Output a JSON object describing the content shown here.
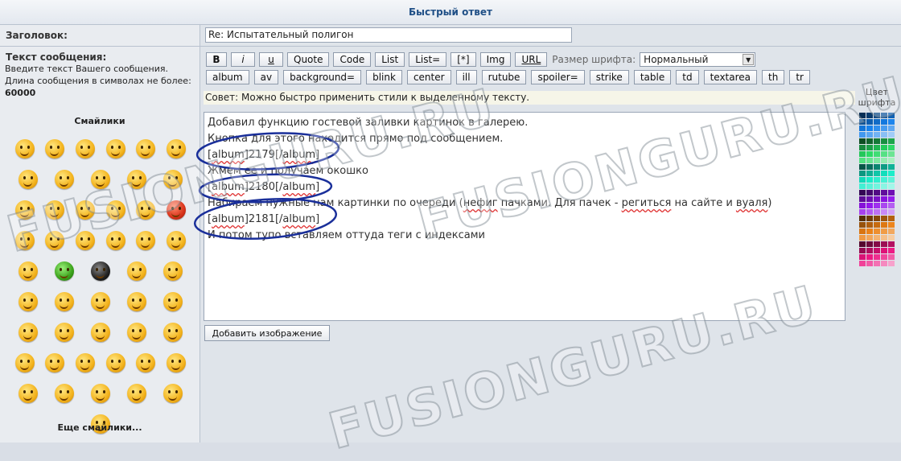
{
  "header": {
    "title": "Быстрый ответ"
  },
  "subject": {
    "label": "Заголовок:",
    "value": "Re: Испытательный полигон"
  },
  "message": {
    "label": "Текст сообщения:",
    "hint1": "Введите текст Вашего сообщения.",
    "hint2": "Длина сообщения в символах не более:",
    "max_len": "60000"
  },
  "smilies": {
    "title": "Смайлики",
    "more": "Еще смайлики..."
  },
  "toolbar": {
    "row1": [
      "B",
      "i",
      "u",
      "Quote",
      "Code",
      "List",
      "List=",
      "[*]",
      "Img",
      "URL"
    ],
    "font_size_label": "Размер шрифта:",
    "font_size_value": "Нормальный",
    "row2": [
      "album",
      "av",
      "background=",
      "blink",
      "center",
      "ill",
      "rutube",
      "spoiler=",
      "strike",
      "table",
      "td",
      "textarea",
      "th",
      "tr"
    ]
  },
  "tip": "Совет: Можно быстро применить стили к выделенному тексту.",
  "editor": {
    "lines": {
      "l1": "Добавил функцию гостевой заливки картинок в галерею.",
      "l2": "Кнопка для этого находится прямо под сообщением.",
      "l3a": "[",
      "l3b": "album",
      "l3c": "]2179[/",
      "l3d": "album",
      "l3e": "]",
      "l4": "Жмем ее и получаем окошко",
      "l5a": "[",
      "l5b": "album",
      "l5c": "]2180[/",
      "l5d": "album",
      "l5e": "]",
      "l6a": "Набираем нужные нам картинки по очереди (",
      "l6b": "нефиг",
      "l6c": " пачками. Для пачек - ",
      "l6d": "региться",
      "l6e": " на сайте и ",
      "l6f": "вуаля",
      "l6g": ")",
      "l7a": "[",
      "l7b": "album",
      "l7c": "]2181[/",
      "l7d": "album",
      "l7e": "]",
      "l8": "И потом тупо вставляем оттуда теги с индексами"
    }
  },
  "add_image_button": "Добавить изображение",
  "palette": {
    "title": "Цвет шрифта"
  },
  "watermark": "FUSIONGURU.RU",
  "colors": {
    "header_text": "#1f4f86",
    "annotation": "#1a2f9a"
  }
}
